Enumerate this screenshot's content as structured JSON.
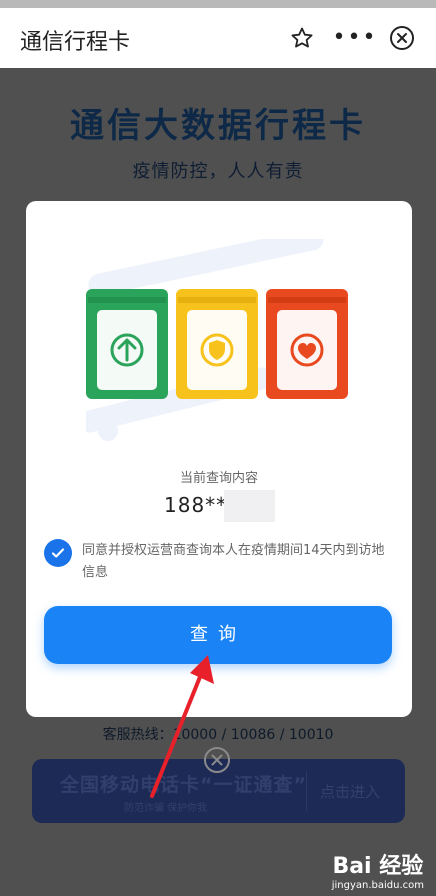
{
  "header": {
    "title": "通信行程卡",
    "more_label": "•••"
  },
  "background": {
    "title": "通信大数据行程卡",
    "subtitle": "疫情防控，人人有责",
    "hotline": "客服热线：10000 / 10086 / 10010",
    "banner_title": "全国移动电话卡“一证通查”",
    "banner_subtitle": "防范诈骗 保护你我",
    "banner_action": "点击进入"
  },
  "modal": {
    "query_label": "当前查询内容",
    "phone_prefix": "188***",
    "consent_text": "同意并授权运营商查询本人在疫情期间14天内到访地信息",
    "query_button": "查询",
    "consent_checked": true
  },
  "watermark": {
    "brand": "Bai 经验",
    "url": "jingyan.baidu.com"
  },
  "colors": {
    "accent": "#1a84f7",
    "green_card": "#2aa35b",
    "yellow_card": "#f7c21b",
    "red_card": "#e8491f",
    "arrow": "#e8202a"
  }
}
